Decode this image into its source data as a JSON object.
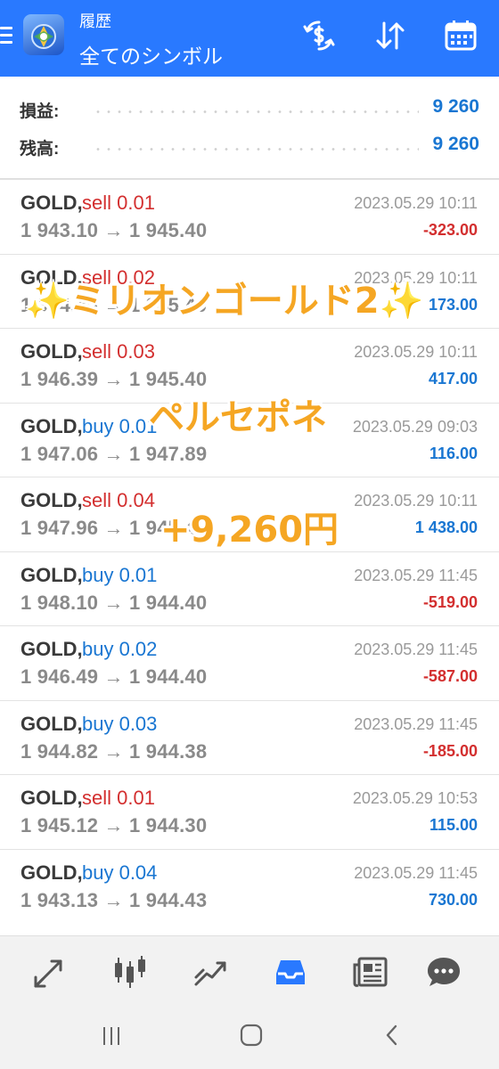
{
  "header": {
    "title": "履歴",
    "subtitle": "全てのシンボル",
    "accent": "#2979ff"
  },
  "summary": {
    "rows": [
      {
        "label": "損益:",
        "value": "9 260"
      },
      {
        "label": "残高:",
        "value": "9 260"
      }
    ]
  },
  "trades": [
    {
      "symbol": "GOLD,",
      "side": "sell 0.01",
      "type": "sell",
      "prices": "1 943.10 → 1 945.40",
      "time": "2023.05.29 10:11",
      "profit": "-323.00",
      "sign": "neg"
    },
    {
      "symbol": "GOLD,",
      "side": "sell 0.02",
      "type": "sell",
      "prices": "1 944.40 → 1 945.40",
      "time": "2023.05.29 10:11",
      "profit": "173.00",
      "sign": "pos"
    },
    {
      "symbol": "GOLD,",
      "side": "sell 0.03",
      "type": "sell",
      "prices": "1 946.39 → 1 945.40",
      "time": "2023.05.29 10:11",
      "profit": "417.00",
      "sign": "pos"
    },
    {
      "symbol": "GOLD,",
      "side": "buy 0.01",
      "type": "buy",
      "prices": "1 947.06 → 1 947.89",
      "time": "2023.05.29 09:03",
      "profit": "116.00",
      "sign": "pos"
    },
    {
      "symbol": "GOLD,",
      "side": "sell 0.04",
      "type": "sell",
      "prices": "1 947.96 → 1 945.40",
      "time": "2023.05.29 10:11",
      "profit": "1 438.00",
      "sign": "pos"
    },
    {
      "symbol": "GOLD,",
      "side": "buy 0.01",
      "type": "buy",
      "prices": "1 948.10 → 1 944.40",
      "time": "2023.05.29 11:45",
      "profit": "-519.00",
      "sign": "neg"
    },
    {
      "symbol": "GOLD,",
      "side": "buy 0.02",
      "type": "buy",
      "prices": "1 946.49 → 1 944.40",
      "time": "2023.05.29 11:45",
      "profit": "-587.00",
      "sign": "neg"
    },
    {
      "symbol": "GOLD,",
      "side": "buy 0.03",
      "type": "buy",
      "prices": "1 944.82 → 1 944.38",
      "time": "2023.05.29 11:45",
      "profit": "-185.00",
      "sign": "neg"
    },
    {
      "symbol": "GOLD,",
      "side": "sell 0.01",
      "type": "sell",
      "prices": "1 945.12 → 1 944.30",
      "time": "2023.05.29 10:53",
      "profit": "115.00",
      "sign": "pos"
    },
    {
      "symbol": "GOLD,",
      "side": "buy 0.04",
      "type": "buy",
      "prices": "1 943.13 → 1 944.43",
      "time": "2023.05.29 11:45",
      "profit": "730.00",
      "sign": "pos"
    }
  ],
  "overlay": {
    "line1": "✨ミリオンゴールド2✨",
    "line2": "ペルセポネ",
    "line3": "+9,260円",
    "color": "#f5a623"
  },
  "bottom_nav": {
    "tabs": [
      {
        "icon": "quotes-arrows-icon"
      },
      {
        "icon": "candlestick-chart-icon"
      },
      {
        "icon": "trade-trend-icon"
      },
      {
        "icon": "history-inbox-icon"
      },
      {
        "icon": "news-icon"
      },
      {
        "icon": "chat-icon"
      }
    ],
    "active": "history-inbox-icon",
    "active_color": "#2979ff"
  },
  "system_nav": {
    "icons": [
      "recent-apps-icon",
      "home-icon",
      "back-icon"
    ]
  }
}
